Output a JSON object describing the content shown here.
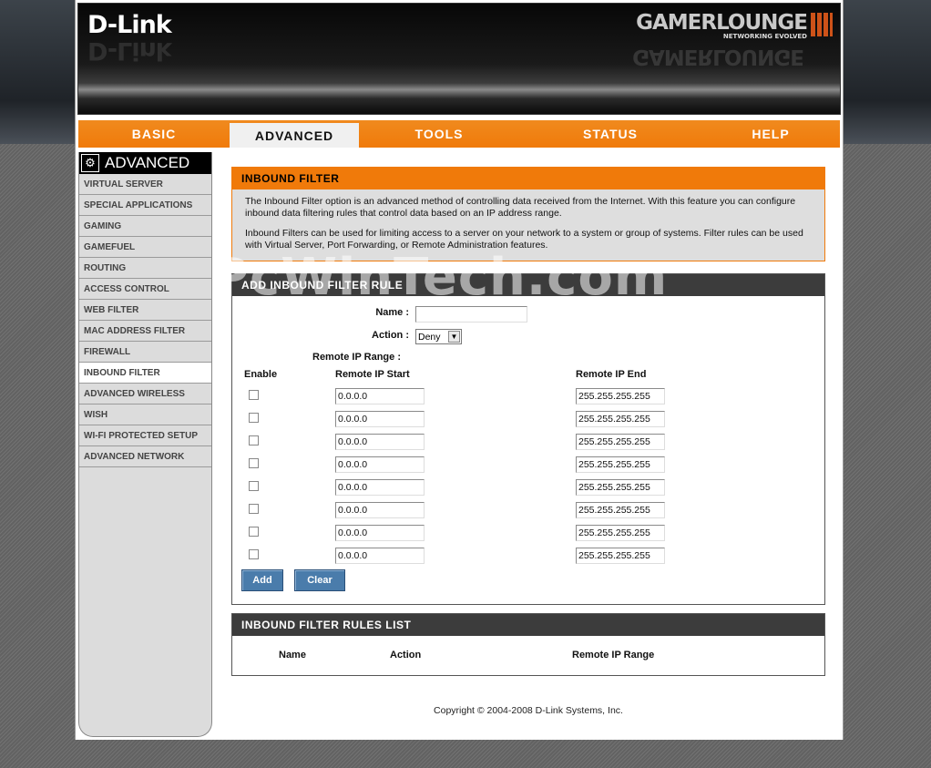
{
  "header": {
    "logo": "D-Link",
    "brand": "GAMERLOUNGE",
    "brand_tagline": "NETWORKING EVOLVED"
  },
  "tabs": [
    {
      "label": "BASIC",
      "active": false
    },
    {
      "label": "ADVANCED",
      "active": true
    },
    {
      "label": "TOOLS",
      "active": false
    },
    {
      "label": "STATUS",
      "active": false
    },
    {
      "label": "HELP",
      "active": false
    }
  ],
  "sidebar": {
    "title": "ADVANCED",
    "items": [
      {
        "label": "VIRTUAL SERVER"
      },
      {
        "label": "SPECIAL APPLICATIONS"
      },
      {
        "label": "GAMING"
      },
      {
        "label": "GAMEFUEL"
      },
      {
        "label": "ROUTING"
      },
      {
        "label": "ACCESS CONTROL"
      },
      {
        "label": "WEB FILTER"
      },
      {
        "label": "MAC ADDRESS FILTER"
      },
      {
        "label": "FIREWALL"
      },
      {
        "label": "INBOUND FILTER",
        "active": true
      },
      {
        "label": "ADVANCED WIRELESS"
      },
      {
        "label": "WISH"
      },
      {
        "label": "WI-FI PROTECTED SETUP"
      },
      {
        "label": "ADVANCED NETWORK"
      }
    ]
  },
  "intro": {
    "title": "INBOUND FILTER",
    "p1": "The Inbound Filter option is an advanced method of controlling data received from the Internet. With this feature you can configure inbound data filtering rules that control data based on an IP address range.",
    "p2": "Inbound Filters can be used for limiting access to a server on your network to a system or group of systems. Filter rules can be used with Virtual Server, Port Forwarding, or Remote Administration features."
  },
  "add_rule": {
    "title": "ADD INBOUND FILTER RULE",
    "name_label": "Name :",
    "name_value": "",
    "action_label": "Action :",
    "action_value": "Deny",
    "range_label": "Remote IP Range :",
    "col_enable": "Enable",
    "col_start": "Remote IP Start",
    "col_end": "Remote IP End",
    "rows": [
      {
        "start": "0.0.0.0",
        "end": "255.255.255.255"
      },
      {
        "start": "0.0.0.0",
        "end": "255.255.255.255"
      },
      {
        "start": "0.0.0.0",
        "end": "255.255.255.255"
      },
      {
        "start": "0.0.0.0",
        "end": "255.255.255.255"
      },
      {
        "start": "0.0.0.0",
        "end": "255.255.255.255"
      },
      {
        "start": "0.0.0.0",
        "end": "255.255.255.255"
      },
      {
        "start": "0.0.0.0",
        "end": "255.255.255.255"
      },
      {
        "start": "0.0.0.0",
        "end": "255.255.255.255"
      }
    ],
    "add_label": "Add",
    "clear_label": "Clear"
  },
  "rules_list": {
    "title": "INBOUND FILTER RULES LIST",
    "col_name": "Name",
    "col_action": "Action",
    "col_range": "Remote IP Range"
  },
  "footer": "Copyright © 2004-2008 D-Link Systems, Inc.",
  "watermark": "PcWinTech.com"
}
